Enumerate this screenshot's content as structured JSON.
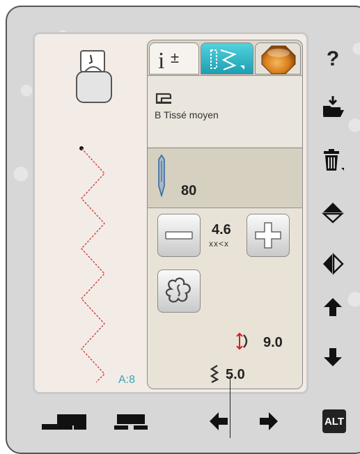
{
  "colors": {
    "accent": "#1c9fb2",
    "stitch": "#d04040",
    "info_text": "#35a6b8",
    "orb": "#d77e1c"
  },
  "preview": {
    "mode_label": "A:8"
  },
  "tabs": [
    {
      "name": "info",
      "icon": "info-plus-minus-icon"
    },
    {
      "name": "stitch",
      "icon": "stitch-menu-icon"
    },
    {
      "name": "settings-orb",
      "icon": "amber-orb-icon"
    }
  ],
  "fabric": {
    "icon": "sewing-machine-icon",
    "label": "B Tissé moyen"
  },
  "needle": {
    "icon": "needle-icon",
    "size": "80"
  },
  "stitch_controls": {
    "width_value": "4.6",
    "width_icon": "stitch-width-icon",
    "decrease_icon": "minus-icon",
    "increase_icon": "plus-icon",
    "mirror_icon": "stitch-repeat-icon",
    "density_value": "9.0",
    "length_value": "5.0"
  },
  "side_icons": [
    "help-icon",
    "open-folder-icon",
    "delete-icon",
    "mirror-vertical-icon",
    "mirror-horizontal-icon",
    "arrow-up-icon",
    "arrow-down-icon"
  ],
  "help_label": "?",
  "bottom": {
    "alt_label": "ALT"
  }
}
